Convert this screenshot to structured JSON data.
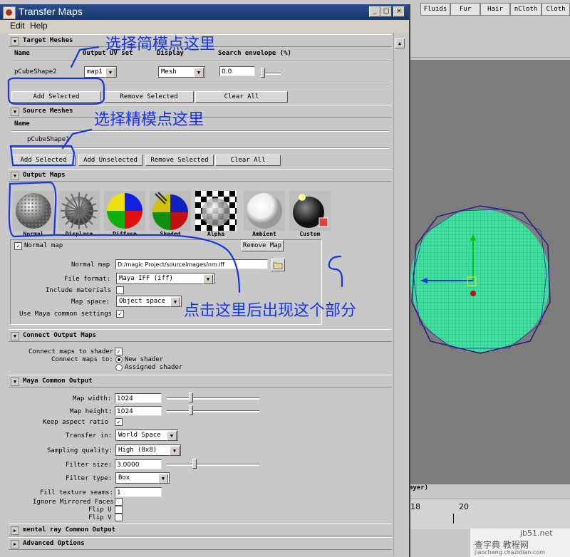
{
  "maya": {
    "shelf_tabs": [
      "Fluids",
      "Fur",
      "Hair",
      "nCloth",
      "Cloth"
    ],
    "timeline_ticks": [
      "18",
      "20"
    ],
    "partial_text": "ayer)"
  },
  "window": {
    "title": "Transfer Maps",
    "min": "_",
    "max": "□",
    "close": "×",
    "menus": [
      "Edit",
      "Help"
    ]
  },
  "target_meshes": {
    "header": "Target Meshes",
    "col_name": "Name",
    "col_uv": "Output UV set",
    "col_display": "Display",
    "col_envelope": "Search envelope (%)",
    "row_name": "pCubeShape2",
    "row_uv": "map1",
    "row_display": "Mesh",
    "row_envelope": "0.0",
    "btn_add": "Add Selected",
    "btn_remove": "Remove Selected",
    "btn_clear": "Clear All"
  },
  "source_meshes": {
    "header": "Source Meshes",
    "col_name": "Name",
    "row_name": "pCubeShape1",
    "btn_add": "Add Selected",
    "btn_add_unsel": "Add Unselected",
    "btn_remove": "Remove Selected",
    "btn_clear": "Clear All"
  },
  "output_maps": {
    "header": "Output Maps",
    "maps": [
      "Normal",
      "Displace",
      "Diffuse",
      "Shaded",
      "Alpha",
      "Ambient",
      "Custom"
    ],
    "normal_check_label": "Normal map",
    "remove_map": "Remove Map",
    "normal_map_label": "Normal map",
    "normal_map_path": "D:/magic Project/sourceimages/nm.iff",
    "file_format_label": "File format:",
    "file_format": "Maya IFF (iff)",
    "include_materials_label": "Include materials",
    "map_space_label": "Map space:",
    "map_space": "Object space",
    "use_common_label": "Use Maya common settings"
  },
  "connect_output": {
    "header": "Connect Output Maps",
    "connect_label": "Connect maps to shader",
    "connect_to_label": "Connect maps to:",
    "opt_new": "New shader",
    "opt_assigned": "Assigned shader"
  },
  "common_output": {
    "header": "Maya Common Output",
    "map_width_label": "Map width:",
    "map_width": "1024",
    "map_height_label": "Map height:",
    "map_height": "1024",
    "keep_aspect_label": "Keep aspect ratio",
    "transfer_in_label": "Transfer in:",
    "transfer_in": "World Space",
    "sampling_label": "Sampling quality:",
    "sampling": "High (8x8)",
    "filter_size_label": "Filter size:",
    "filter_size": "3.0000",
    "filter_type_label": "Filter type:",
    "filter_type": "Box",
    "fill_seams_label": "Fill texture seams:",
    "fill_seams": "1",
    "ignore_mirrored_label": "Ignore Mirrored Faces",
    "flip_u_label": "Flip U",
    "flip_v_label": "Flip V"
  },
  "collapsed_sections": [
    "mental ray Common Output",
    "Advanced Options"
  ],
  "annotations": {
    "a1": "选择简模点这里",
    "a2": "选择精模点这里",
    "a3": "点击这里后出现这个部分"
  },
  "watermark": {
    "line1": "jb51.net",
    "line2": "查字典 教程网",
    "line3": "jiaocheng.chazidian.com"
  },
  "colors": {
    "annotation": "#1a35e0",
    "title_bar": "#1f4380",
    "mesh_green": "#3fe0a0"
  }
}
